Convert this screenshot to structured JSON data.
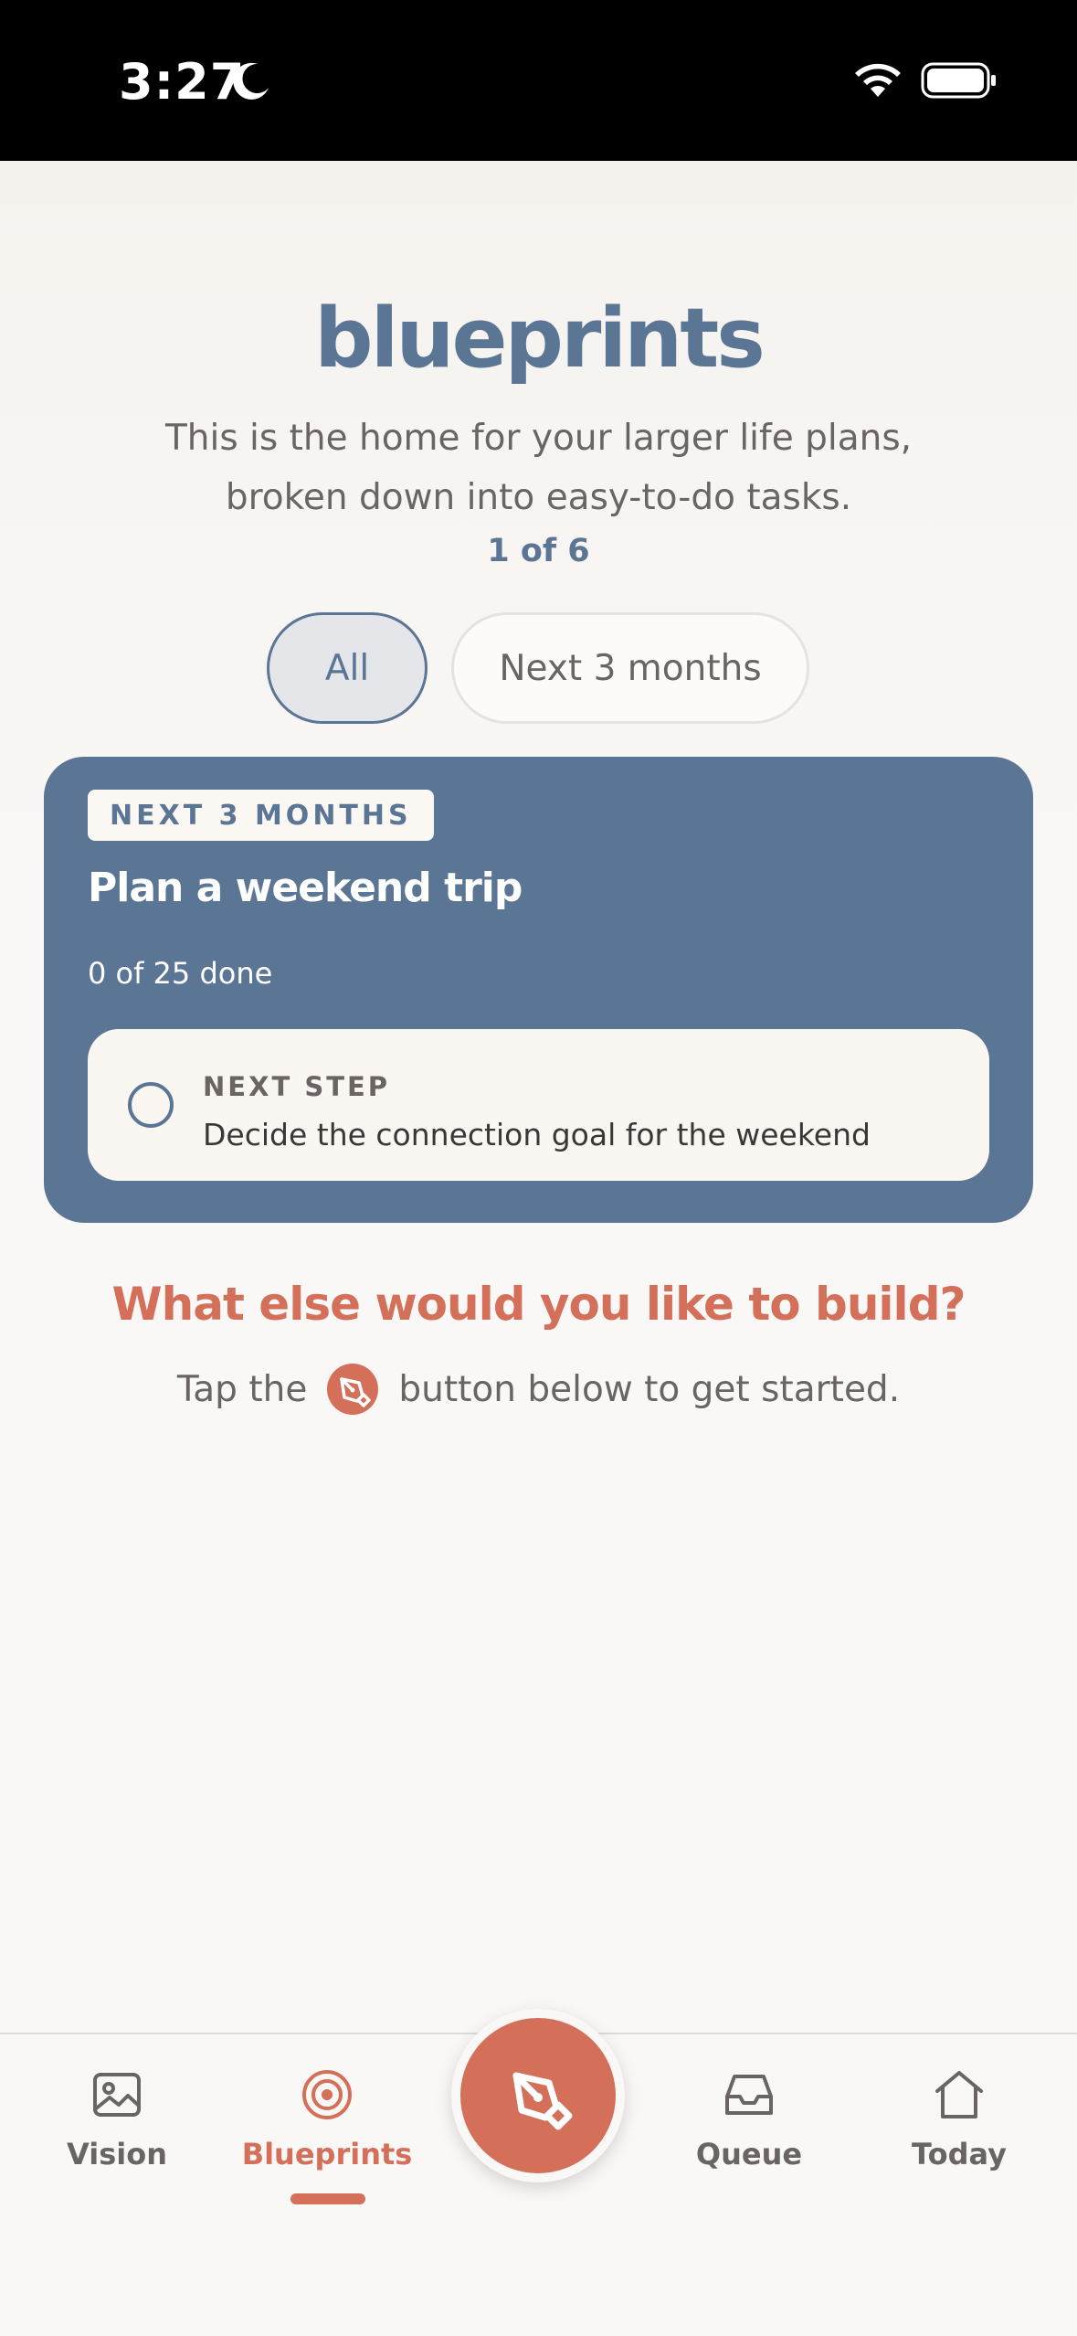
{
  "status_bar": {
    "time": "3:27",
    "focus_icon": "moon-icon",
    "wifi_icon": "wifi-icon",
    "battery_icon": "battery-icon"
  },
  "header": {
    "title": "blueprints",
    "subtitle": "This is the home for your larger life plans, broken down into easy-to-do tasks.",
    "pager": "1 of 6"
  },
  "filters": {
    "options": [
      {
        "label": "All",
        "selected": true
      },
      {
        "label": "Next 3 months",
        "selected": false
      }
    ]
  },
  "blueprint_card": {
    "tag": "NEXT 3 MONTHS",
    "title": "Plan a weekend trip",
    "progress": "0 of 25 done",
    "done_count": 0,
    "total_count": 25,
    "next_step": {
      "label": "NEXT STEP",
      "text": "Decide the connection goal for the weekend"
    }
  },
  "prompt": {
    "question": "What else would you like to build?",
    "hint_before": "Tap the",
    "hint_after": "button below to get started.",
    "hint_icon": "pen-nib-icon"
  },
  "tab_bar": {
    "tabs": [
      {
        "label": "Vision",
        "icon": "image-icon",
        "active": false
      },
      {
        "label": "Blueprints",
        "icon": "target-icon",
        "active": true
      },
      {
        "label": "Queue",
        "icon": "inbox-icon",
        "active": false
      },
      {
        "label": "Today",
        "icon": "home-icon",
        "active": false
      }
    ],
    "fab_icon": "pen-nib-icon"
  },
  "colors": {
    "primary_blue": "#5b7595",
    "accent_coral": "#d4705a",
    "background": "#faf8f5"
  }
}
